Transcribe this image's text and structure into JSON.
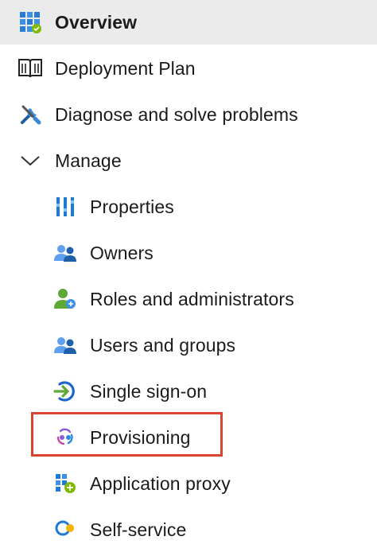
{
  "menu": {
    "overview": {
      "label": "Overview",
      "icon": "overview-grid-icon"
    },
    "deployment_plan": {
      "label": "Deployment Plan",
      "icon": "book-icon"
    },
    "diagnose": {
      "label": "Diagnose and solve problems",
      "icon": "wrench-screwdriver-icon"
    },
    "manage": {
      "label": "Manage",
      "icon": "chevron-down-icon"
    },
    "properties": {
      "label": "Properties",
      "icon": "properties-bars-icon"
    },
    "owners": {
      "label": "Owners",
      "icon": "users-icon"
    },
    "roles": {
      "label": "Roles and administrators",
      "icon": "user-role-icon"
    },
    "users_groups": {
      "label": "Users and groups",
      "icon": "users-icon"
    },
    "sso": {
      "label": "Single sign-on",
      "icon": "sign-in-arrow-icon"
    },
    "provisioning": {
      "label": "Provisioning",
      "icon": "provisioning-cycle-icon"
    },
    "app_proxy": {
      "label": "Application proxy",
      "icon": "application-proxy-icon"
    },
    "self_service": {
      "label": "Self-service",
      "icon": "self-service-icon"
    }
  },
  "colors": {
    "selected_background": "#ebebeb",
    "highlight_border": "#d9432f",
    "azure_blue": "#0078d4"
  }
}
